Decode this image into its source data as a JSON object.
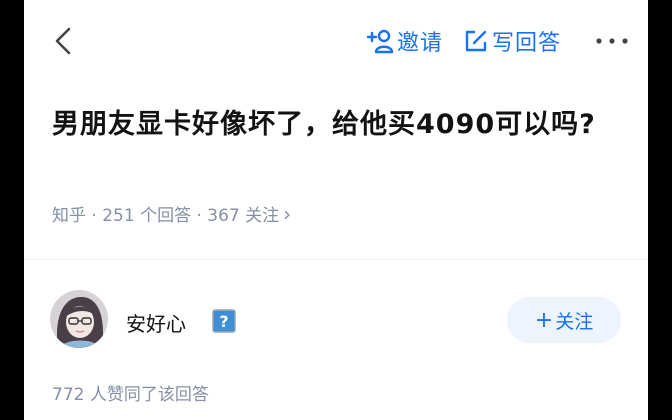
{
  "header": {
    "back_icon": "chevron-left-icon",
    "invite_label": "邀请",
    "invite_icon": "add-person-icon",
    "write_answer_label": "写回答",
    "write_answer_icon": "edit-icon",
    "more_icon": "more-dots-icon",
    "accent_color": "#1772f6"
  },
  "question": {
    "title": "男朋友显卡好像坏了，给他买4090可以吗?",
    "meta": "知乎 · 251 个回答 · 367 关注",
    "meta_chevron": "›"
  },
  "answer": {
    "author_name": "安好心",
    "badge_icon": "question-badge-icon",
    "badge_text": "?",
    "follow_label": "关注",
    "follow_plus": "+",
    "votes_text": "772 人赞同了该回答"
  }
}
